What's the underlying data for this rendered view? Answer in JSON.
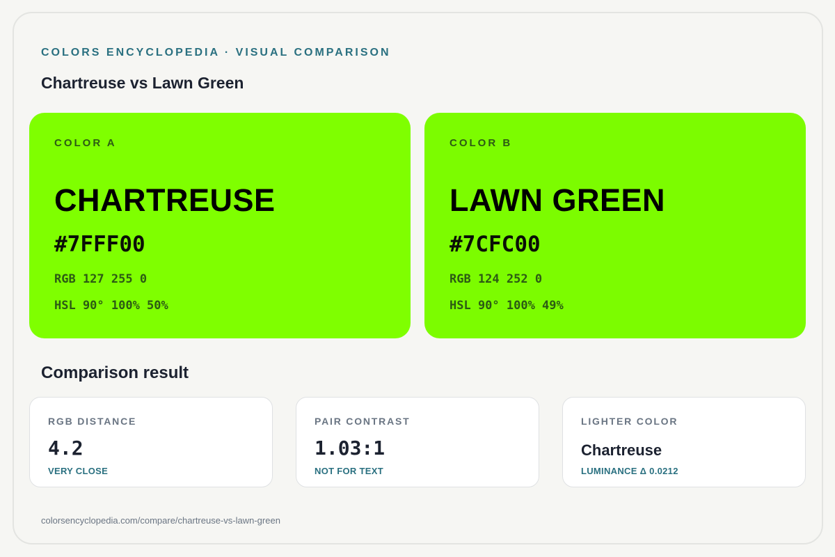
{
  "header": {
    "eyebrow": "COLORS ENCYCLOPEDIA · VISUAL COMPARISON",
    "title": "Chartreuse vs Lawn Green"
  },
  "colors": [
    {
      "label": "COLOR A",
      "name": "CHARTREUSE",
      "hex": "#7FFF00",
      "rgb": "RGB 127 255 0",
      "hsl": "HSL 90° 100% 50%",
      "swatch_color": "#7FFF00"
    },
    {
      "label": "COLOR B",
      "name": "LAWN GREEN",
      "hex": "#7CFC00",
      "rgb": "RGB 124 252 0",
      "hsl": "HSL 90° 100% 49%",
      "swatch_color": "#7CFC00"
    }
  ],
  "comparison": {
    "title": "Comparison result",
    "cards": [
      {
        "label": "RGB DISTANCE",
        "value": "4.2",
        "note": "VERY CLOSE"
      },
      {
        "label": "PAIR CONTRAST",
        "value": "1.03:1",
        "note": "NOT FOR TEXT"
      },
      {
        "label": "LIGHTER COLOR",
        "value": "Chartreuse",
        "note": "LUMINANCE Δ 0.0212"
      }
    ]
  },
  "footer": {
    "url": "colorsencyclopedia.com/compare/chartreuse-vs-lawn-green"
  },
  "theme": {
    "accent": "#2a7080",
    "background": "#f6f6f3"
  }
}
